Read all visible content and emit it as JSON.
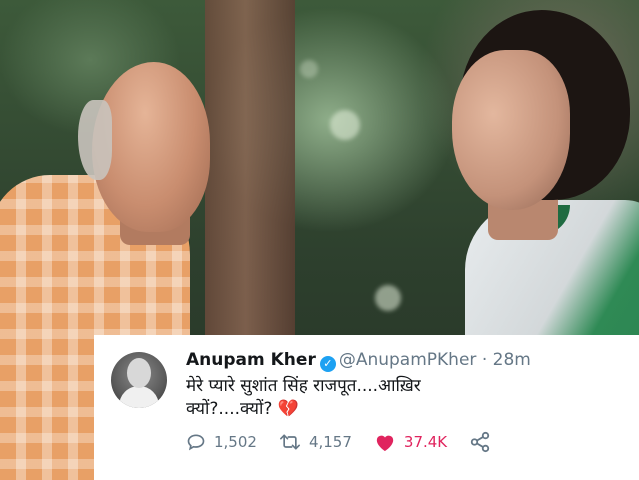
{
  "tweet": {
    "name": "Anupam Kher",
    "handle": "@AnupamPKher",
    "separator": "·",
    "time": "28m",
    "text_line1": "मेरे प्यारे सुशांत सिंह राजपूत....आख़िर",
    "text_line2": "क्यों?....क्यों?",
    "emoji": "💔",
    "replies": "1,502",
    "retweets": "4,157",
    "likes": "37.4K",
    "verified_mark": "✓"
  },
  "colors": {
    "like": "#e0245e",
    "verified": "#1da1f2",
    "muted": "#657786"
  },
  "icons": [
    "reply-icon",
    "retweet-icon",
    "heart-icon",
    "share-icon",
    "verified-badge-icon"
  ]
}
